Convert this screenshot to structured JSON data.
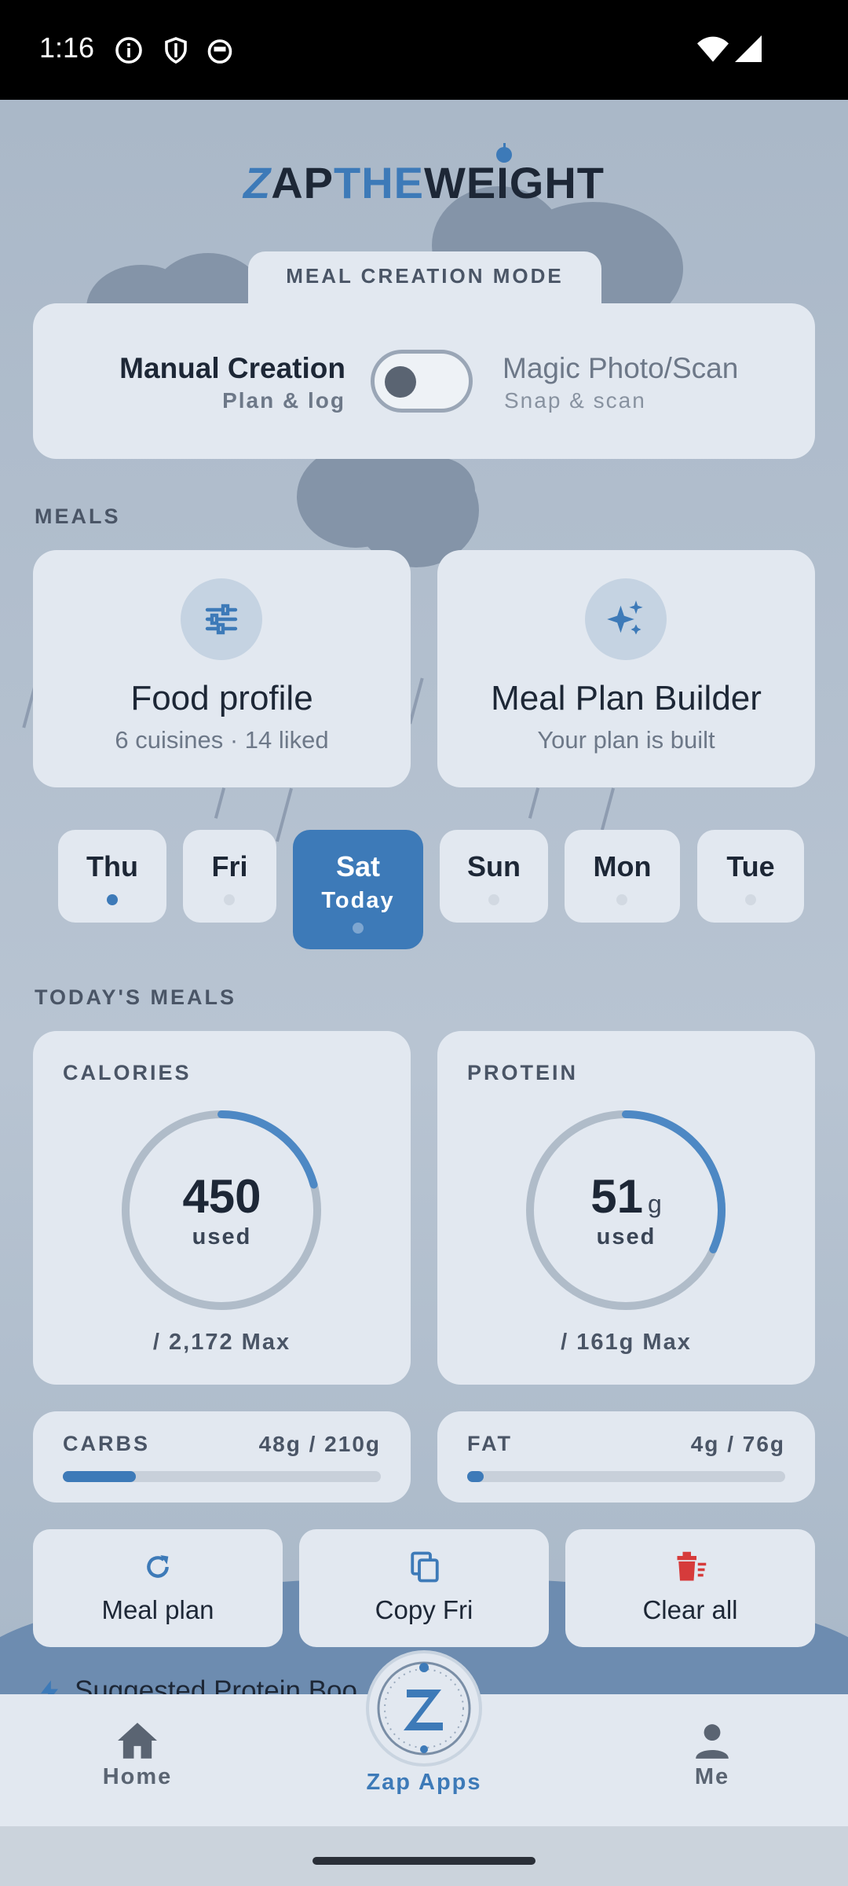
{
  "status_bar": {
    "time": "1:16"
  },
  "logo": {
    "z": "Z",
    "ap": "AP",
    "the": "THE",
    "weight": "WEIGHT"
  },
  "mode": {
    "tab_label": "MEAL CREATION MODE",
    "left_title": "Manual Creation",
    "left_sub": "Plan & log",
    "right_title": "Magic Photo/Scan",
    "right_sub": "Snap & scan"
  },
  "meals": {
    "section_label": "MEALS",
    "cards": [
      {
        "title": "Food profile",
        "subtitle": "6 cuisines · 14 liked",
        "icon": "sliders-icon"
      },
      {
        "title": "Meal Plan Builder",
        "subtitle": "Your plan is built",
        "icon": "sparkle-icon"
      }
    ]
  },
  "days": [
    {
      "name": "Thu",
      "sub": ""
    },
    {
      "name": "Fri",
      "sub": ""
    },
    {
      "name": "Sat",
      "sub": "Today"
    },
    {
      "name": "Sun",
      "sub": ""
    },
    {
      "name": "Mon",
      "sub": ""
    },
    {
      "name": "Tue",
      "sub": ""
    }
  ],
  "today": {
    "section_label": "TODAY'S MEALS",
    "calories": {
      "label": "CALORIES",
      "value": "450",
      "used": "used",
      "max": "/ 2,172 Max",
      "fraction": 0.207
    },
    "protein": {
      "label": "PROTEIN",
      "value": "51",
      "unit": "g",
      "used": "used",
      "max": "/ 161g Max",
      "fraction": 0.317
    },
    "carbs": {
      "label": "CARBS",
      "value": "48g / 210g",
      "fraction": 0.229
    },
    "fat": {
      "label": "FAT",
      "value": "4g / 76g",
      "fraction": 0.053
    }
  },
  "actions": [
    {
      "label": "Meal plan",
      "icon": "refresh-icon"
    },
    {
      "label": "Copy Fri",
      "icon": "copy-icon"
    },
    {
      "label": "Clear all",
      "icon": "trash-icon"
    }
  ],
  "suggestion_peek": "Suggested Protein Boo",
  "nav": {
    "home": "Home",
    "zap": "Zap Apps",
    "me": "Me"
  },
  "colors": {
    "accent": "#3d7ab8",
    "danger": "#d63b3b",
    "card": "#e2e8f0"
  }
}
